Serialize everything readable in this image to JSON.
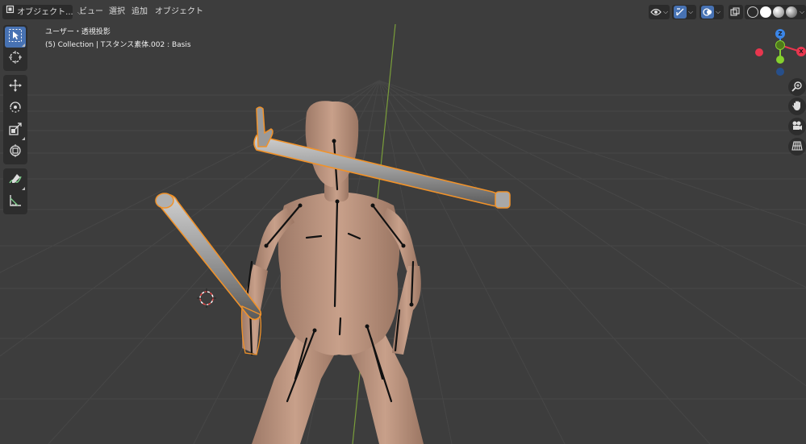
{
  "header": {
    "mode_label": "オブジェクト...",
    "menu": [
      "ビュー",
      "選択",
      "追加",
      "オブジェクト"
    ]
  },
  "overlay": {
    "view_name": "ユーザー・透視投影",
    "collection_info": "(5) Collection | Tスタンス素体.002 : Basis"
  },
  "toolbar": {
    "tools": [
      "select-box",
      "cursor",
      "move",
      "rotate",
      "scale",
      "transform",
      "annotate",
      "measure"
    ],
    "active": "select-box"
  },
  "gizmo": {
    "axes": [
      "Z",
      "X",
      "Y"
    ],
    "colors": {
      "x": "#e8364e",
      "y": "#85d12e",
      "z": "#3b86e8",
      "neg_z": "#274f8a"
    }
  },
  "viewport": {
    "background": "#3d3d3d",
    "grid_color": "#4a4a4a",
    "y_axis_color": "#7a9e3a",
    "selection_outline": "#f0922a",
    "skin_color": "#c29a85"
  },
  "right_nav": [
    "zoom-icon",
    "pan-hand-icon",
    "camera-icon",
    "ortho-grid-icon"
  ]
}
